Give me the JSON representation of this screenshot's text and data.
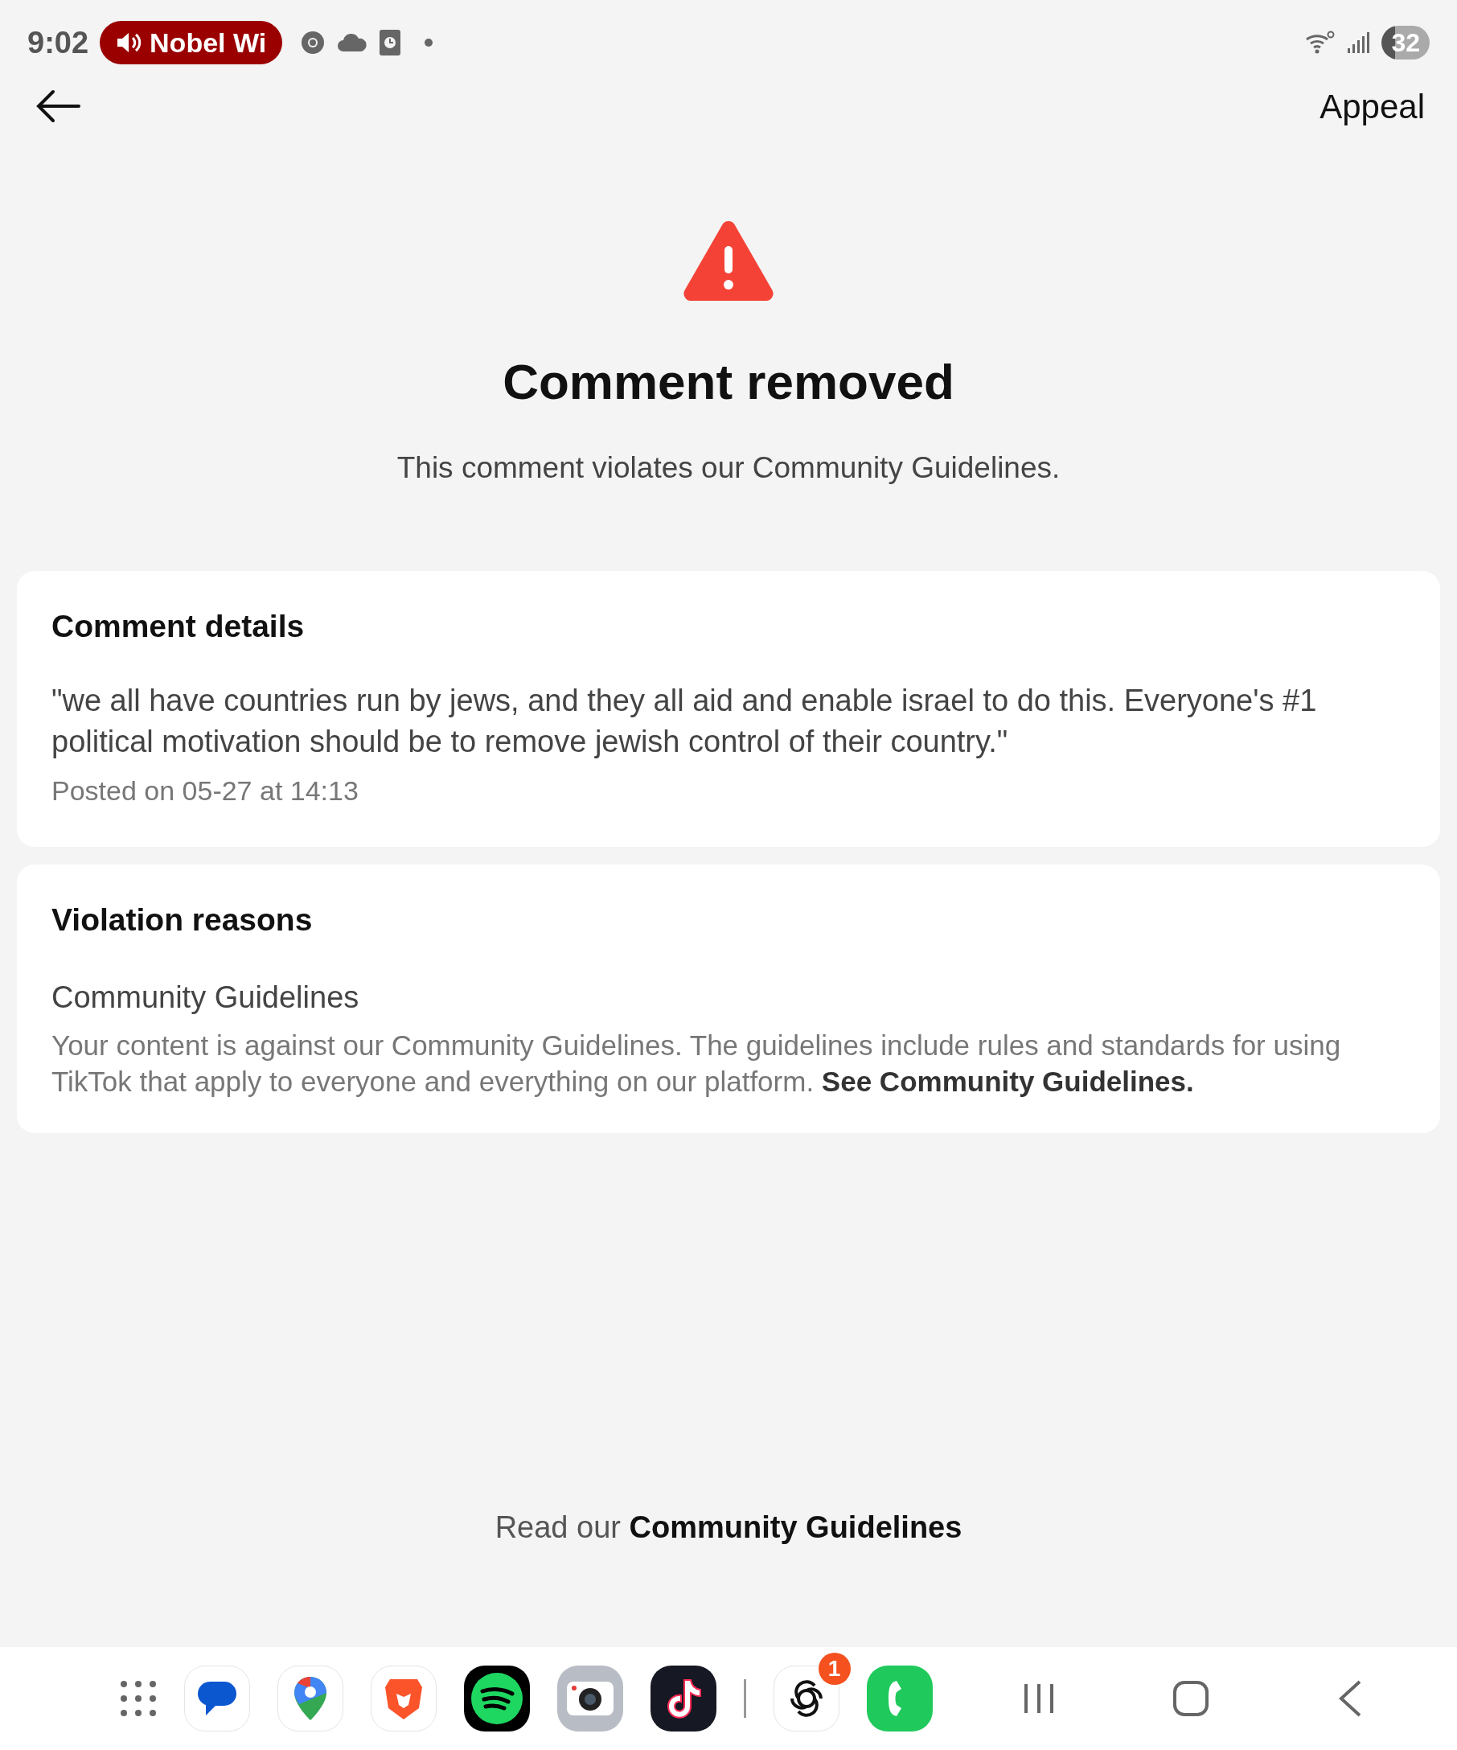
{
  "status_bar": {
    "time": "9:02",
    "media_chip": "Nobel Wi",
    "battery": "32"
  },
  "header": {
    "action": "Appeal"
  },
  "alert": {
    "title": "Comment removed",
    "message": "This comment violates our Community Guidelines."
  },
  "comment_card": {
    "heading": "Comment details",
    "comment": "\"we all have countries run by jews, and they all aid and enable israel to do this. Everyone's #1 political motivation should be to remove jewish control of their country.\"",
    "posted": "Posted on 05-27 at 14:13"
  },
  "violation_card": {
    "heading": "Violation reasons",
    "reason_title": "Community Guidelines",
    "reason_body": "Your content is against our Community Guidelines. The guidelines include rules and standards for using TikTok that apply to everyone and everything on our platform.",
    "link": "See Community Guidelines."
  },
  "footer": {
    "prefix": "Read our",
    "link": "Community Guidelines"
  },
  "dock": {
    "badge": "1"
  }
}
